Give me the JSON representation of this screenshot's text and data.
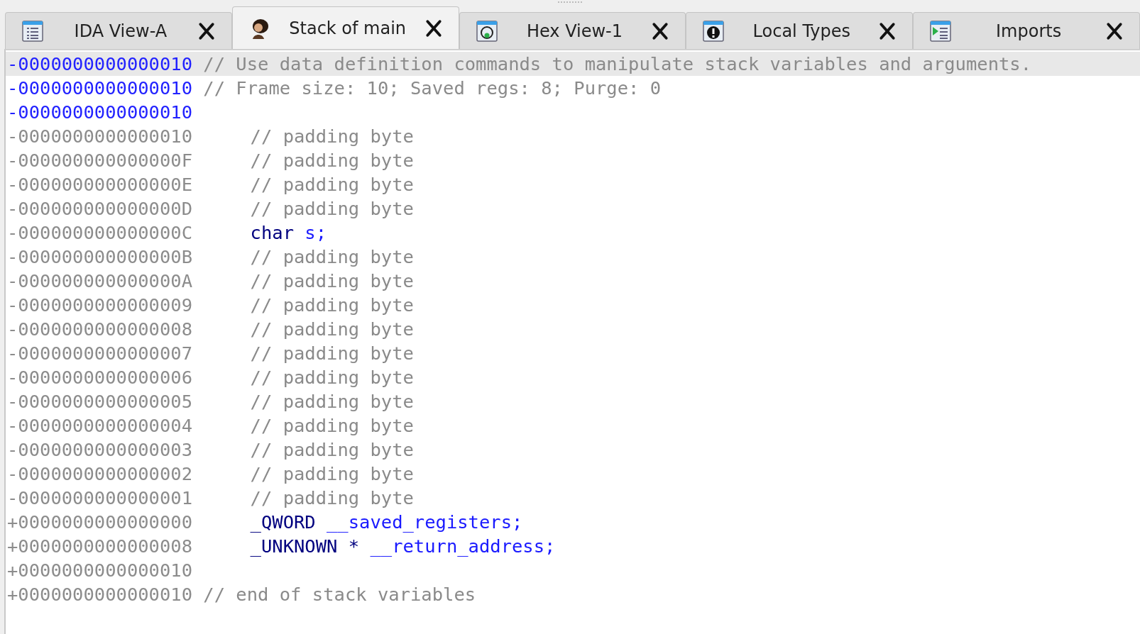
{
  "tabs": [
    {
      "label": "IDA View-A",
      "kind": "listing",
      "selected": false
    },
    {
      "label": "Stack of main",
      "kind": "portrait",
      "selected": true
    },
    {
      "label": "Hex View-1",
      "kind": "hex",
      "selected": false
    },
    {
      "label": "Local Types",
      "kind": "info",
      "selected": false
    },
    {
      "label": "Imports",
      "kind": "imports",
      "selected": false
    }
  ],
  "lines": [
    {
      "address": "-0000000000000010",
      "defined": true,
      "current": true,
      "kind": "header_comment",
      "comment": "// Use data definition commands to manipulate stack variables and arguments."
    },
    {
      "address": "-0000000000000010",
      "defined": true,
      "current": false,
      "kind": "header_comment",
      "comment": "// Frame size: 10; Saved regs: 8; Purge: 0"
    },
    {
      "address": "-0000000000000010",
      "defined": true,
      "current": false,
      "kind": "blank"
    },
    {
      "address": "-0000000000000010",
      "defined": false,
      "current": false,
      "kind": "member_comment",
      "comment": "// padding byte"
    },
    {
      "address": "-000000000000000F",
      "defined": false,
      "current": false,
      "kind": "member_comment",
      "comment": "// padding byte"
    },
    {
      "address": "-000000000000000E",
      "defined": false,
      "current": false,
      "kind": "member_comment",
      "comment": "// padding byte"
    },
    {
      "address": "-000000000000000D",
      "defined": false,
      "current": false,
      "kind": "member_comment",
      "comment": "// padding byte"
    },
    {
      "address": "-000000000000000C",
      "defined": false,
      "current": false,
      "kind": "member",
      "type": "char",
      "name": "s;"
    },
    {
      "address": "-000000000000000B",
      "defined": false,
      "current": false,
      "kind": "member_comment",
      "comment": "// padding byte"
    },
    {
      "address": "-000000000000000A",
      "defined": false,
      "current": false,
      "kind": "member_comment",
      "comment": "// padding byte"
    },
    {
      "address": "-0000000000000009",
      "defined": false,
      "current": false,
      "kind": "member_comment",
      "comment": "// padding byte"
    },
    {
      "address": "-0000000000000008",
      "defined": false,
      "current": false,
      "kind": "member_comment",
      "comment": "// padding byte"
    },
    {
      "address": "-0000000000000007",
      "defined": false,
      "current": false,
      "kind": "member_comment",
      "comment": "// padding byte"
    },
    {
      "address": "-0000000000000006",
      "defined": false,
      "current": false,
      "kind": "member_comment",
      "comment": "// padding byte"
    },
    {
      "address": "-0000000000000005",
      "defined": false,
      "current": false,
      "kind": "member_comment",
      "comment": "// padding byte"
    },
    {
      "address": "-0000000000000004",
      "defined": false,
      "current": false,
      "kind": "member_comment",
      "comment": "// padding byte"
    },
    {
      "address": "-0000000000000003",
      "defined": false,
      "current": false,
      "kind": "member_comment",
      "comment": "// padding byte"
    },
    {
      "address": "-0000000000000002",
      "defined": false,
      "current": false,
      "kind": "member_comment",
      "comment": "// padding byte"
    },
    {
      "address": "-0000000000000001",
      "defined": false,
      "current": false,
      "kind": "member_comment",
      "comment": "// padding byte"
    },
    {
      "address": "+0000000000000000",
      "defined": false,
      "current": false,
      "kind": "member",
      "type": "_QWORD",
      "name": "__saved_registers;"
    },
    {
      "address": "+0000000000000008",
      "defined": false,
      "current": false,
      "kind": "member",
      "type": "_UNKNOWN *",
      "name": "__return_address;"
    },
    {
      "address": "+0000000000000010",
      "defined": false,
      "current": false,
      "kind": "blank"
    },
    {
      "address": "+0000000000000010",
      "defined": false,
      "current": false,
      "kind": "header_comment",
      "comment": "// end of stack variables"
    }
  ]
}
